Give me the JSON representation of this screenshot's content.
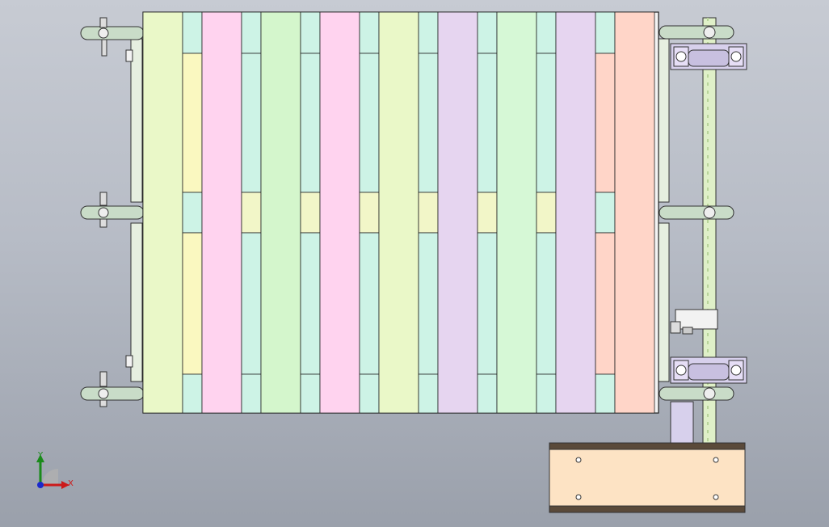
{
  "viewport": {
    "axes": {
      "x_label": "X",
      "y_label": "Y"
    },
    "slat_colors": [
      "#eaf8c8",
      "#ffd3ef",
      "#d4f6cc",
      "#ffd3ef",
      "#eaf8c8",
      "#e6d5f0",
      "#d6f8d6",
      "#e6d5f0",
      "#ffd5c8"
    ],
    "gap_colors_top": [
      "#cdf3e6",
      "#cdf3e6",
      "#cdf3e6",
      "#cdf3e6",
      "#cdf3e6",
      "#cdf3e6",
      "#cdf3e6",
      "#cdf3e6"
    ],
    "gap_colors_a": [
      "#faf8c0",
      "#cdf3e6",
      "#cdf3e6",
      "#cdf3e6",
      "#cdf3e6",
      "#cdf3e6",
      "#cdf3e6",
      "#ffd5c8"
    ],
    "gap_colors_mid": [
      "#cdf3e6",
      "#f2f6c8",
      "#f2f6c8",
      "#f2f6c8",
      "#f2f6c8",
      "#f2f6c8",
      "#f2f6c8",
      "#cdf3e6"
    ],
    "gap_colors_b": [
      "#faf8c0",
      "#cdf3e6",
      "#cdf3e6",
      "#cdf3e6",
      "#cdf3e6",
      "#cdf3e6",
      "#cdf3e6",
      "#ffd5c8"
    ],
    "gap_colors_bot": [
      "#cdf3e6",
      "#cdf3e6",
      "#cdf3e6",
      "#cdf3e6",
      "#cdf3e6",
      "#cdf3e6",
      "#cdf3e6",
      "#cdf3e6"
    ],
    "part_colors": {
      "chain": "#c9dcc8",
      "bearing": "#d7d0ec",
      "motor_box": "#fde3c4",
      "shaft": "#dff0c8",
      "frame_edge": "#e6efe0"
    }
  }
}
